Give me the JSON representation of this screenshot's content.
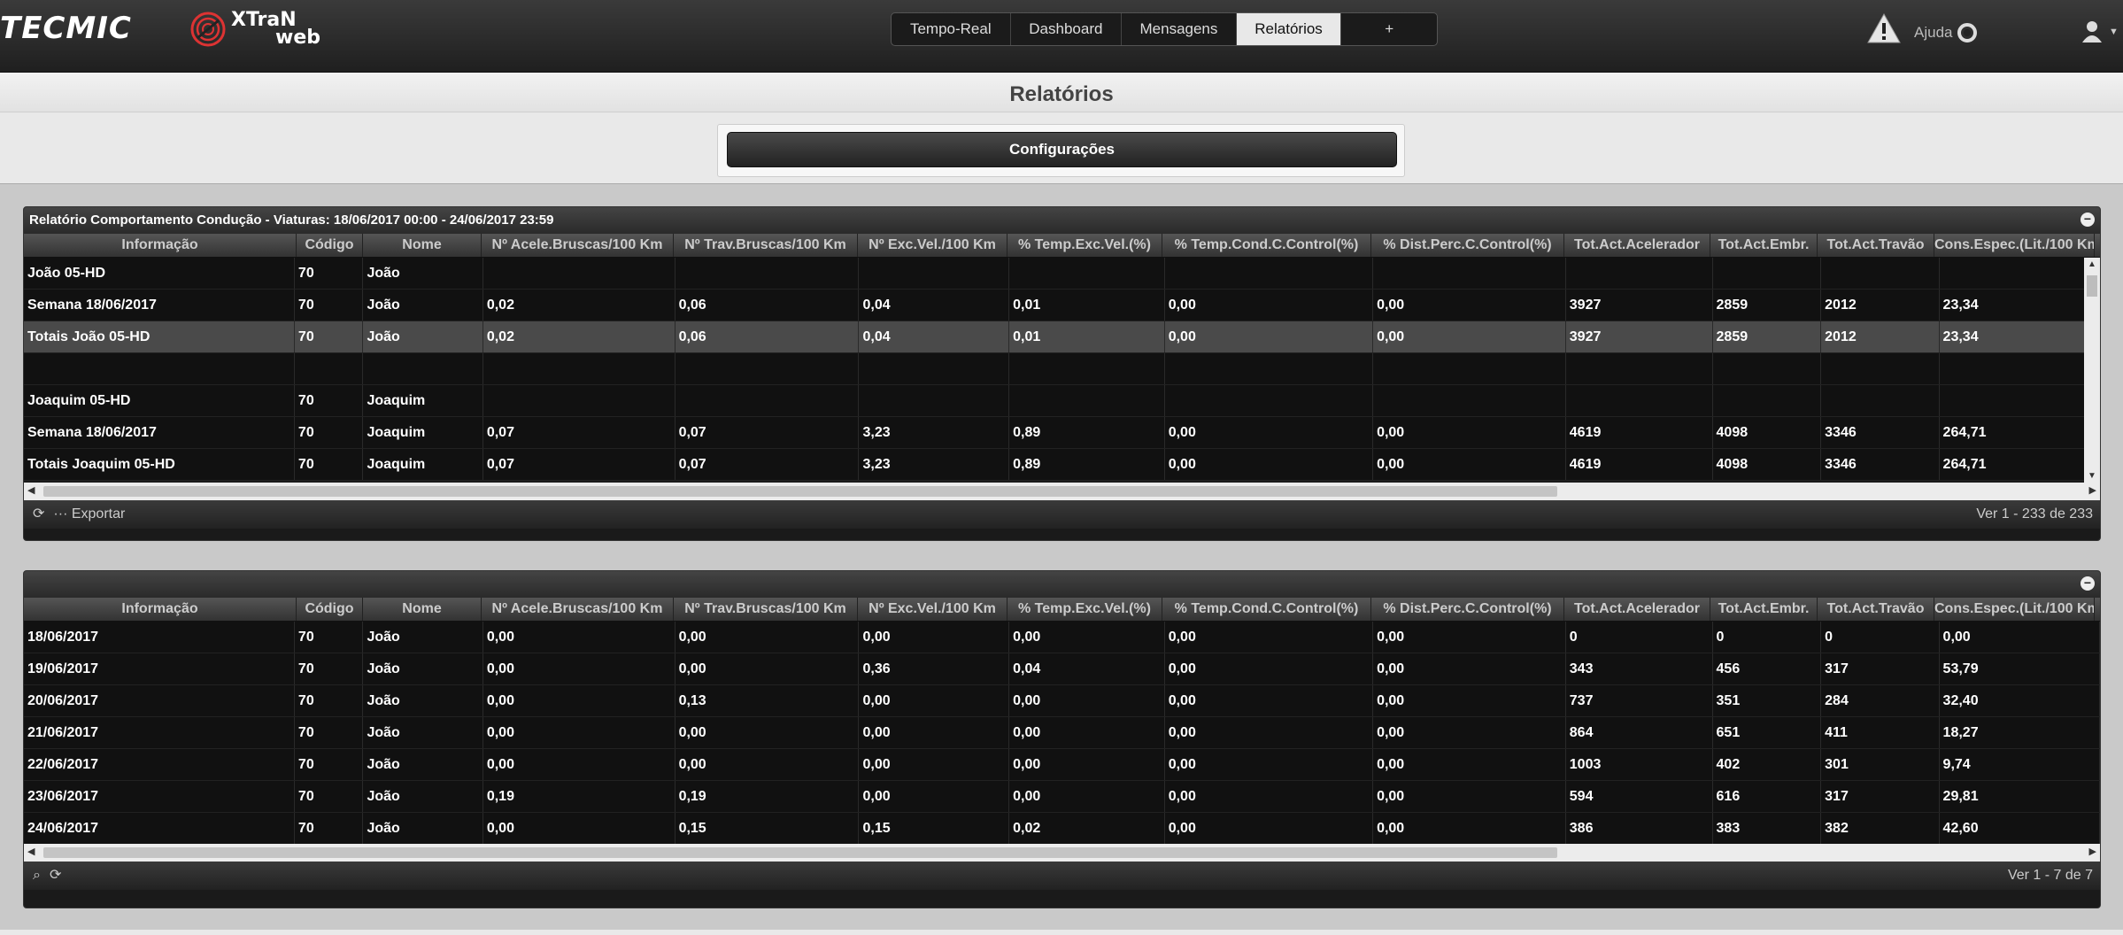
{
  "app": {
    "brand": "TECMIC",
    "product_line1": "XTraN",
    "product_line2": "web"
  },
  "nav": {
    "items": [
      {
        "label": "Tempo-Real",
        "active": false
      },
      {
        "label": "Dashboard",
        "active": false
      },
      {
        "label": "Mensagens",
        "active": false
      },
      {
        "label": "Relatórios",
        "active": true
      },
      {
        "label": "+",
        "active": false
      }
    ]
  },
  "header": {
    "help_label": "Ajuda"
  },
  "page": {
    "title": "Relatórios",
    "config_label": "Configurações"
  },
  "columns": [
    "Informação",
    "Código",
    "Nome",
    "Nº Acele.Bruscas/100 Km",
    "Nº Trav.Bruscas/100 Km",
    "Nº Exc.Vel./100 Km",
    "% Temp.Exc.Vel.(%)",
    "% Temp.Cond.C.Control(%)",
    "% Dist.Perc.C.Control(%)",
    "Tot.Act.Acelerador",
    "Tot.Act.Embr.",
    "Tot.Act.Travão",
    "Cons.Espec.(Lit./100 Km"
  ],
  "report1": {
    "caption": "Relatório Comportamento Condução - Viaturas: 18/06/2017 00:00 - 24/06/2017 23:59",
    "export_label": "Exportar",
    "pager_text": "Ver 1 - 233 de 233",
    "rows": [
      [
        "João 05-HD",
        "70",
        "João",
        "",
        "",
        "",
        "",
        "",
        "",
        "",
        "",
        "",
        ""
      ],
      [
        "Semana 18/06/2017",
        "70",
        "João",
        "0,02",
        "0,06",
        "0,04",
        "0,01",
        "0,00",
        "0,00",
        "3927",
        "2859",
        "2012",
        "23,34"
      ],
      [
        "Totais João 05-HD",
        "70",
        "João",
        "0,02",
        "0,06",
        "0,04",
        "0,01",
        "0,00",
        "0,00",
        "3927",
        "2859",
        "2012",
        "23,34"
      ],
      [
        "",
        "",
        "",
        "",
        "",
        "",
        "",
        "",
        "",
        "",
        "",
        "",
        ""
      ],
      [
        "Joaquim 05-HD",
        "70",
        "Joaquim",
        "",
        "",
        "",
        "",
        "",
        "",
        "",
        "",
        "",
        ""
      ],
      [
        "Semana 18/06/2017",
        "70",
        "Joaquim",
        "0,07",
        "0,07",
        "3,23",
        "0,89",
        "0,00",
        "0,00",
        "4619",
        "4098",
        "3346",
        "264,71"
      ],
      [
        "Totais Joaquim 05-HD",
        "70",
        "Joaquim",
        "0,07",
        "0,07",
        "3,23",
        "0,89",
        "0,00",
        "0,00",
        "4619",
        "4098",
        "3346",
        "264,71"
      ]
    ],
    "selected_row": 2
  },
  "report2": {
    "caption": "",
    "pager_text": "Ver 1 - 7 de 7",
    "rows": [
      [
        "18/06/2017",
        "70",
        "João",
        "0,00",
        "0,00",
        "0,00",
        "0,00",
        "0,00",
        "0,00",
        "0",
        "0",
        "0",
        "0,00"
      ],
      [
        "19/06/2017",
        "70",
        "João",
        "0,00",
        "0,00",
        "0,36",
        "0,04",
        "0,00",
        "0,00",
        "343",
        "456",
        "317",
        "53,79"
      ],
      [
        "20/06/2017",
        "70",
        "João",
        "0,00",
        "0,13",
        "0,00",
        "0,00",
        "0,00",
        "0,00",
        "737",
        "351",
        "284",
        "32,40"
      ],
      [
        "21/06/2017",
        "70",
        "João",
        "0,00",
        "0,00",
        "0,00",
        "0,00",
        "0,00",
        "0,00",
        "864",
        "651",
        "411",
        "18,27"
      ],
      [
        "22/06/2017",
        "70",
        "João",
        "0,00",
        "0,00",
        "0,00",
        "0,00",
        "0,00",
        "0,00",
        "1003",
        "402",
        "301",
        "9,74"
      ],
      [
        "23/06/2017",
        "70",
        "João",
        "0,19",
        "0,19",
        "0,00",
        "0,00",
        "0,00",
        "0,00",
        "594",
        "616",
        "317",
        "29,81"
      ],
      [
        "24/06/2017",
        "70",
        "João",
        "0,00",
        "0,15",
        "0,15",
        "0,02",
        "0,00",
        "0,00",
        "386",
        "383",
        "382",
        "42,60"
      ]
    ]
  }
}
